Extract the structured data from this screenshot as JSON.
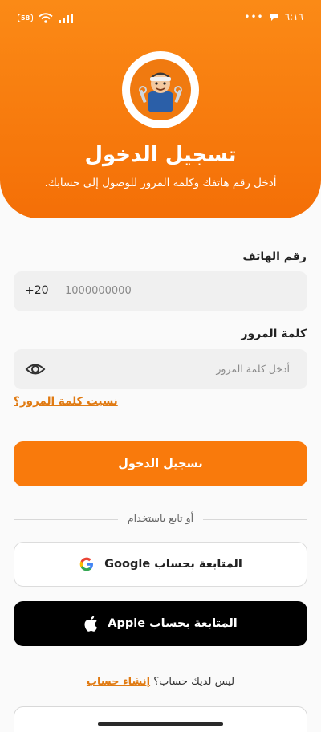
{
  "status_bar": {
    "battery": "58",
    "time": "٦:١٦"
  },
  "header": {
    "logo_icon": "mechanic-logo-icon",
    "title": "تسجيل الدخول",
    "subtitle": "أدخل رقم هاتفك وكلمة المرور للوصول إلى حسابك."
  },
  "phone": {
    "label": "رقم الهاتف",
    "country_code": "+20",
    "placeholder": "1000000000"
  },
  "password": {
    "label": "كلمة المرور",
    "placeholder": "أدخل كلمة المرور",
    "toggle_icon": "eye-icon"
  },
  "forgot_password": "نسيت كلمة المرور؟",
  "login_button": "تسجيل الدخول",
  "divider_text": "أو تابع باستخدام",
  "google_button": {
    "label": "المتابعة بحساب Google",
    "icon": "google-icon"
  },
  "apple_button": {
    "label": "المتابعة بحساب Apple",
    "icon": "apple-icon"
  },
  "signup": {
    "prompt": "ليس لديك حساب؟",
    "link": "إنشاء حساب"
  },
  "colors": {
    "accent": "#f97a0c",
    "header_top": "#fb8a16",
    "link": "#e07a12"
  }
}
